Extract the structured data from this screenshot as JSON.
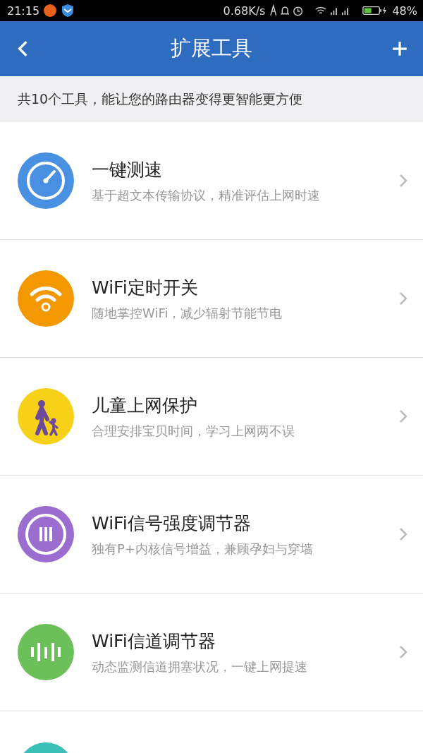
{
  "status_bar": {
    "time": "21:15",
    "net_speed": "0.68K/s",
    "battery": "48%"
  },
  "header": {
    "title": "扩展工具"
  },
  "summary": "共10个工具，能让您的路由器变得更智能更方便",
  "tools": [
    {
      "kind": "speed",
      "color": "#4a90e2",
      "title": "一键测速",
      "subtitle": "基于超文本传输协议，精准评估上网时速"
    },
    {
      "kind": "wifi",
      "color": "#f39800",
      "title": "WiFi定时开关",
      "subtitle": "随地掌控WiFi，减少辐射节能节电"
    },
    {
      "kind": "family",
      "color": "#f7d117",
      "title": "儿童上网保护",
      "subtitle": "合理安排宝贝时间，学习上网两不误"
    },
    {
      "kind": "signal",
      "color": "#9b6dcf",
      "title": "WiFi信号强度调节器",
      "subtitle": "独有P+内核信号增益，兼顾孕妇与穿墙"
    },
    {
      "kind": "channel",
      "color": "#6cc05a",
      "title": "WiFi信道调节器",
      "subtitle": "动态监测信道拥塞状况，一键上网提速"
    },
    {
      "kind": "partial",
      "color": "#3bc0b8"
    }
  ]
}
